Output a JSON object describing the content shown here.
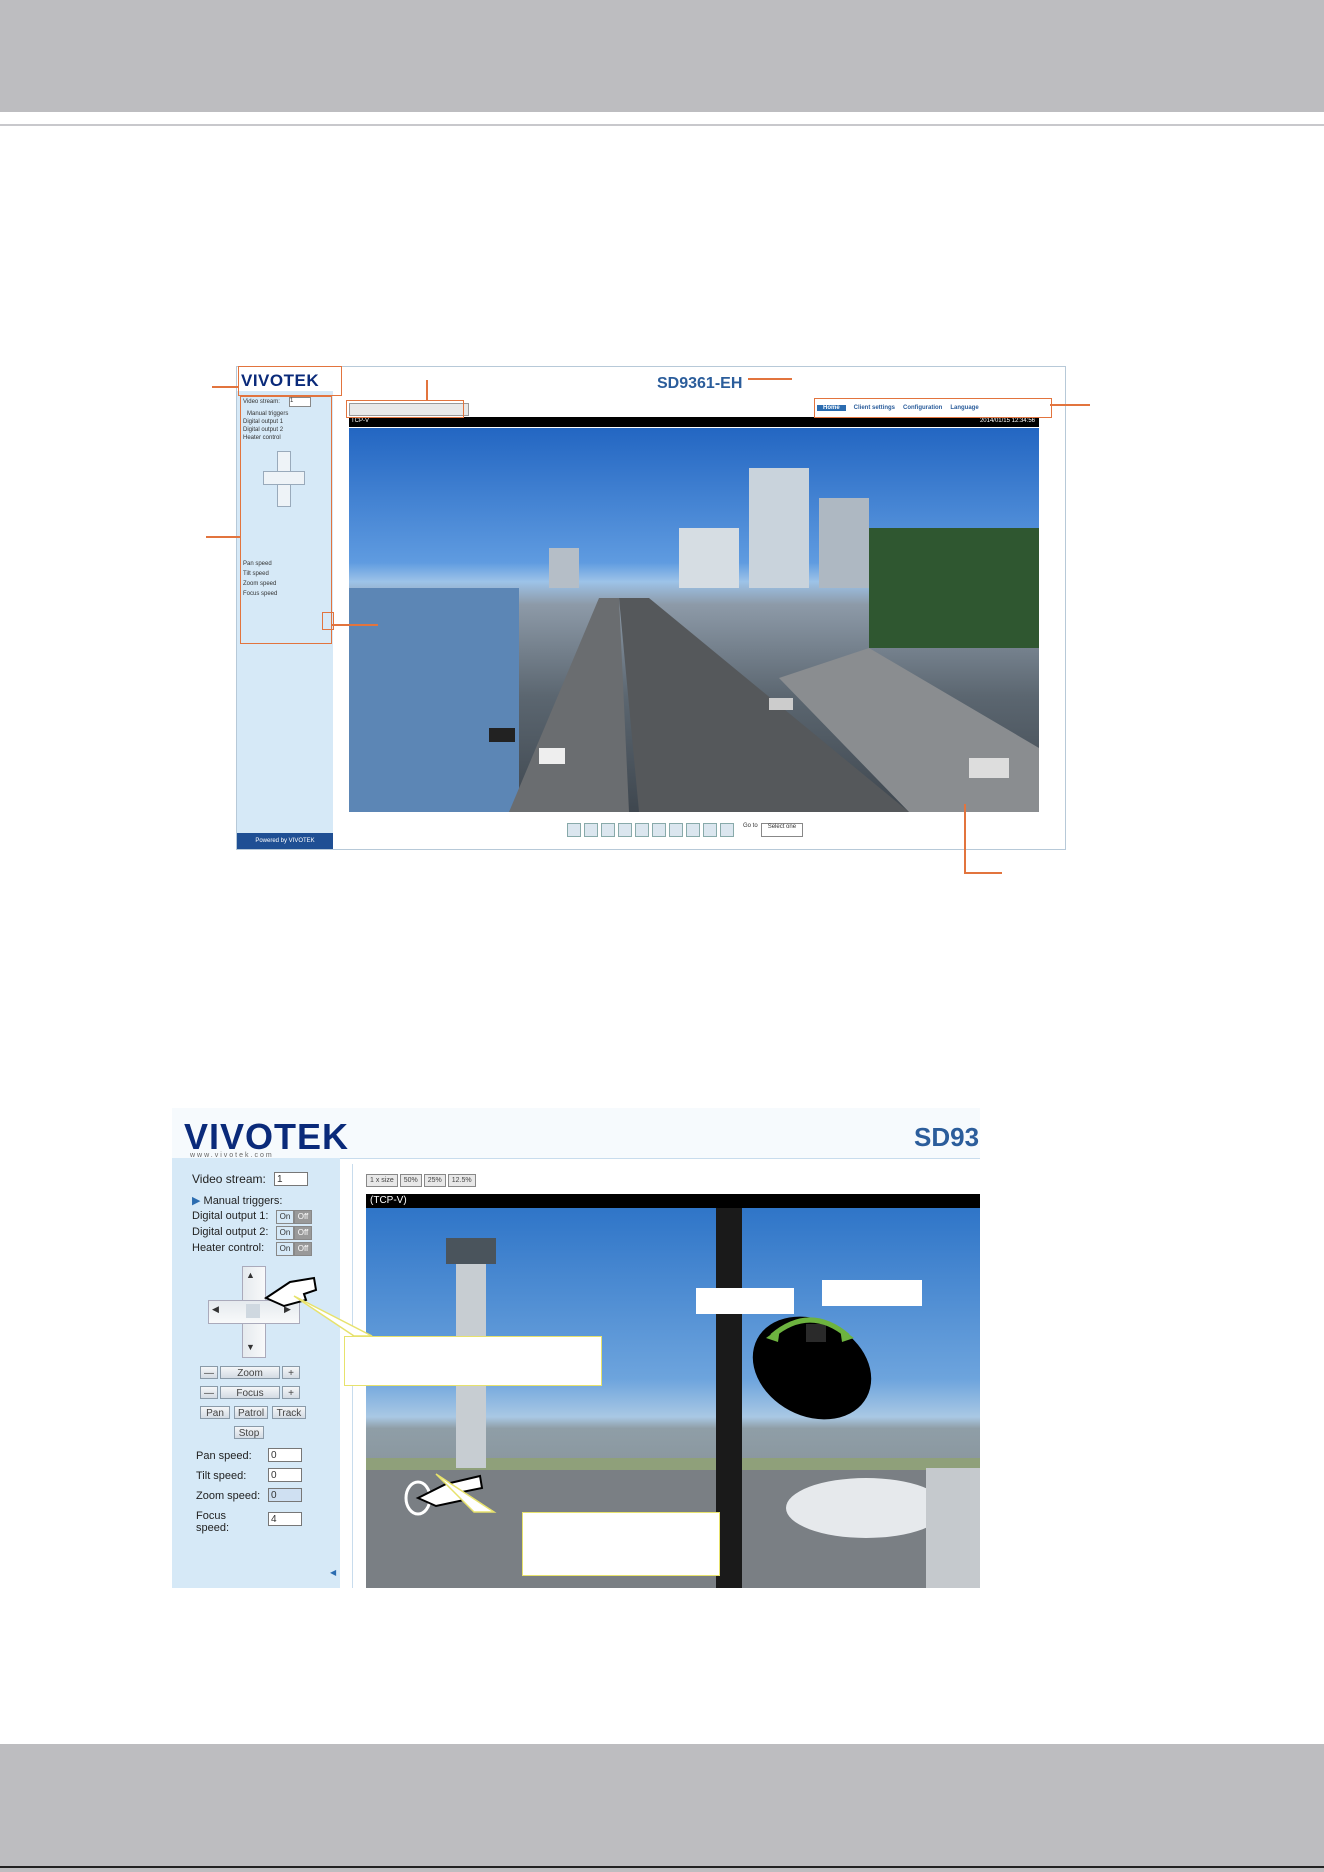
{
  "screenshot1": {
    "logo": "VIVOTEK",
    "title": "SD9361-EH",
    "video_stream_label": "Video stream:",
    "video_stream_value": "1",
    "manual_triggers": "Manual triggers",
    "digital_output_1": "Digital output 1",
    "digital_output_2": "Digital output 2",
    "heater_control": "Heater control",
    "pan_speed": "Pan speed",
    "tilt_speed": "Tilt speed",
    "zoom_speed": "Zoom speed",
    "focus_speed": "Focus speed",
    "nav": [
      "Home",
      "Client settings",
      "Configuration",
      "Language"
    ],
    "video_label": "TCP-V",
    "timestamp": "2014/01/15 12:34:56",
    "goto_label": "Go to",
    "goto_value": "Select one",
    "powered_by": "Powered by VIVOTEK"
  },
  "screenshot2": {
    "logo": "VIVOTEK",
    "logo_sub": "www.vivotek.com",
    "title": "SD93",
    "video_stream_label": "Video stream:",
    "video_stream_value": "1",
    "manual_triggers": "Manual triggers:",
    "digital_output_1": "Digital output 1:",
    "digital_output_2": "Digital output 2:",
    "heater_control": "Heater control:",
    "on": "On",
    "off": "Off",
    "zoom": "Zoom",
    "focus": "Focus",
    "pan": "Pan",
    "patrol": "Patrol",
    "track": "Track",
    "stop": "Stop",
    "pan_speed": "Pan speed:",
    "pan_speed_value": "0",
    "tilt_speed": "Tilt speed:",
    "tilt_speed_value": "0",
    "zoom_speed": "Zoom speed:",
    "zoom_speed_value": "0",
    "focus_speed": "Focus speed:",
    "focus_speed_value": "4",
    "video_label": "(TCP-V)",
    "size_buttons": [
      "1 x size",
      "50%",
      "25%",
      "12.5%"
    ]
  }
}
